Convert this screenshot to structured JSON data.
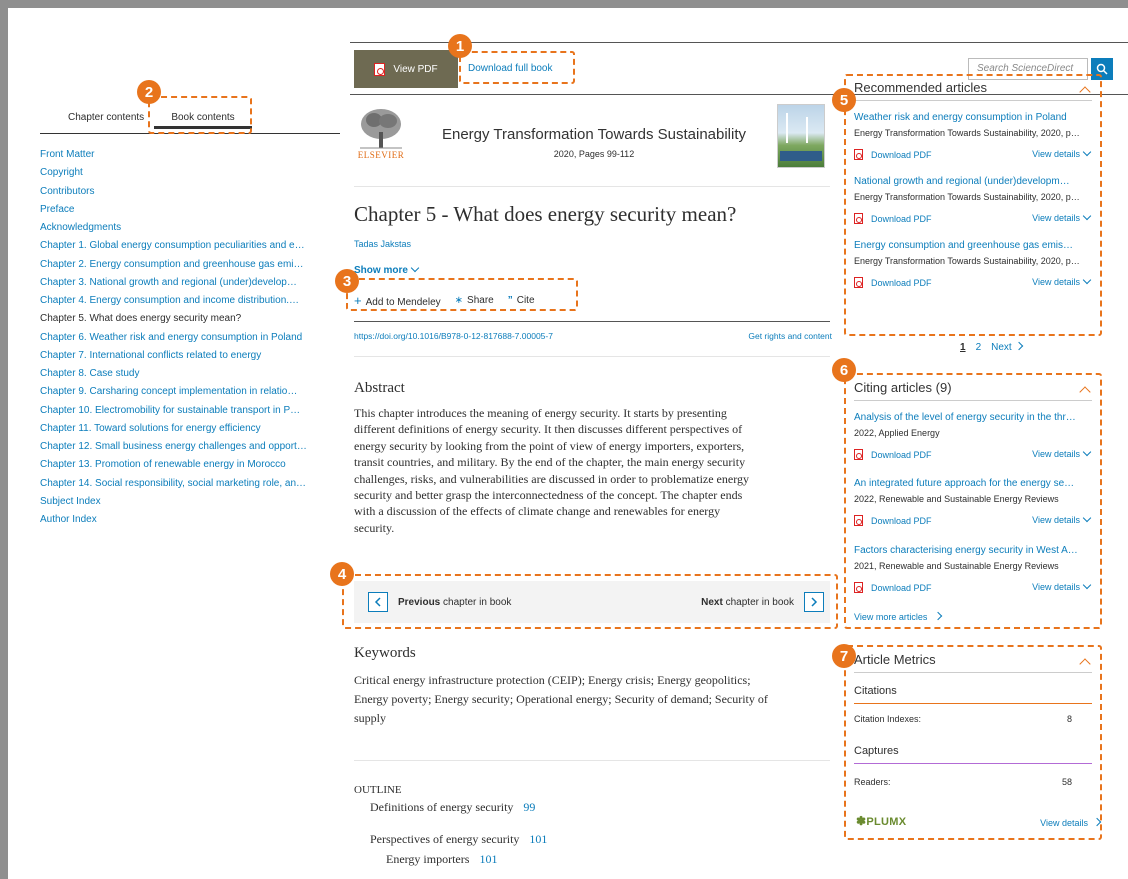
{
  "left_nav": {
    "tabs": [
      "Chapter contents",
      "Book contents"
    ],
    "items": [
      "Front Matter",
      "Copyright",
      "Contributors",
      "Preface",
      "Acknowledgments",
      "Chapter 1. Global energy consumption peculiarities and e…",
      "Chapter 2. Energy consumption and greenhouse gas emi…",
      "Chapter 3. National growth and regional (under)develop…",
      "Chapter 4. Energy consumption and income distribution.…",
      "Chapter 5. What does energy security mean?",
      "Chapter 6. Weather risk and energy consumption in Poland",
      "Chapter 7. International conflicts related to energy",
      "Chapter 8. Case study",
      "Chapter 9. Carsharing concept implementation in relatio…",
      "Chapter 10. Electromobility for sustainable transport in P…",
      "Chapter 11. Toward solutions for energy efficiency",
      "Chapter 12. Small business energy challenges and opport…",
      "Chapter 13. Promotion of renewable energy in Morocco",
      "Chapter 14. Social responsibility, social marketing role, an…",
      "Subject Index",
      "Author Index"
    ],
    "current_index": 9
  },
  "topbar": {
    "view_pdf": "View PDF",
    "download_book": "Download full book",
    "search_placeholder": "Search ScienceDirect"
  },
  "book": {
    "publisher": "ELSEVIER",
    "title": "Energy Transformation Towards Sustainability",
    "year_pages": "2020, Pages 99-112"
  },
  "chapter": {
    "title": "Chapter 5 - What does energy security mean?",
    "author": "Tadas Jakstas",
    "show_more": "Show more",
    "actions": [
      "Add to Mendeley",
      "Share",
      "Cite"
    ],
    "doi": "https://doi.org/10.1016/B978-0-12-817688-7.00005-7",
    "rights": "Get rights and content"
  },
  "abstract": {
    "heading": "Abstract",
    "lines": [
      "This chapter introduces the meaning of energy security. It starts by presenting",
      "different definitions of energy security. It then discusses different perspectives of",
      "energy security by looking from the point of view of energy importers, exporters,",
      "transit countries, and military. By the end of the chapter, the main energy security",
      "challenges, risks, and vulnerabilities are discussed in order to problematize energy",
      "security and better grasp the interconnectedness of the concept. The chapter ends",
      "with a discussion of the effects of climate change and renewables for energy",
      "security."
    ]
  },
  "chapter_nav": {
    "previous_bold": "Previous",
    "previous_rest": "chapter in book",
    "next_bold": "Next",
    "next_rest": "chapter in book"
  },
  "keywords": {
    "heading": "Keywords",
    "lines": [
      "Critical energy infrastructure protection (CEIP); Energy crisis; Energy geopolitics;",
      "Energy poverty; Energy security; Operational energy; Security of demand; Security of",
      "supply"
    ]
  },
  "outline": {
    "heading": "OUTLINE",
    "items": [
      {
        "label": "Definitions of energy security",
        "page": "99"
      },
      {
        "label": "Perspectives of energy security",
        "page": "101"
      },
      {
        "label": "Energy importers",
        "page": "101"
      }
    ]
  },
  "recommended": {
    "heading": "Recommended articles",
    "articles": [
      {
        "title": "Weather risk and energy consumption in Poland",
        "source": "Energy Transformation Towards Sustainability, 2020, p…"
      },
      {
        "title": "National growth and regional (under)developm…",
        "source": "Energy Transformation Towards Sustainability, 2020, p…"
      },
      {
        "title": "Energy consumption and greenhouse gas emis…",
        "source": "Energy Transformation Towards Sustainability, 2020, p…"
      }
    ],
    "download_label": "Download PDF",
    "details_label": "View details",
    "pager": {
      "current": "1",
      "next_page": "2",
      "next": "Next"
    }
  },
  "citing": {
    "heading": "Citing articles (9)",
    "articles": [
      {
        "title": "Analysis of the level of energy security in the thr…",
        "source": "2022, Applied Energy"
      },
      {
        "title": "An integrated future approach for the energy se…",
        "source": "2022, Renewable and Sustainable Energy Reviews"
      },
      {
        "title": "Factors characterising energy security in West A…",
        "source": "2021, Renewable and Sustainable Energy Reviews"
      }
    ],
    "view_more": "View more articles"
  },
  "metrics": {
    "heading": "Article Metrics",
    "citations_heading": "Citations",
    "citation_indexes_label": "Citation Indexes:",
    "citation_indexes_value": "8",
    "captures_heading": "Captures",
    "readers_label": "Readers:",
    "readers_value": "58",
    "plumx": "PLUMX",
    "view_details": "View details"
  },
  "annotations": [
    "1",
    "2",
    "3",
    "4",
    "5",
    "6",
    "7"
  ],
  "colors": {
    "accent": "#e8741c",
    "link": "#0c7dbb",
    "pdf_button": "#6e6a52",
    "citations_rule": "#e8741c",
    "captures_rule": "#b36bd6"
  }
}
